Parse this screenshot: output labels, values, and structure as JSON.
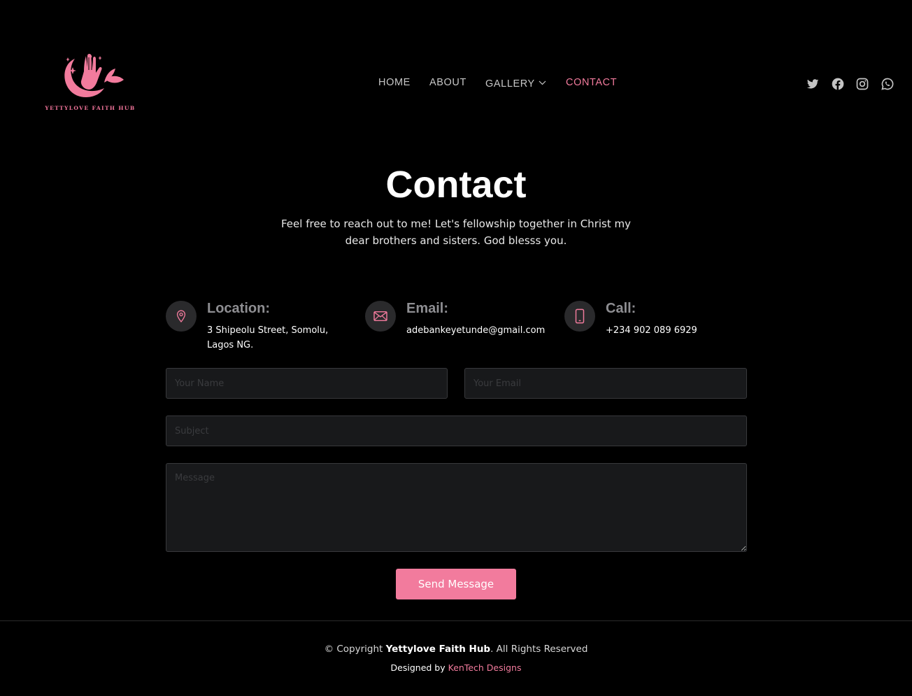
{
  "brand": {
    "logo_text": "YETTYLOVE FAITH HUB",
    "accent_color": "#f27b9d"
  },
  "nav": {
    "items": [
      {
        "label": "HOME"
      },
      {
        "label": "ABOUT"
      },
      {
        "label": "GALLERY"
      },
      {
        "label": "CONTACT",
        "active": true
      }
    ]
  },
  "social": {
    "icons": [
      "twitter-icon",
      "facebook-icon",
      "instagram-icon",
      "whatsapp-icon"
    ]
  },
  "hero": {
    "title": "Contact",
    "intro": "Feel free to reach out to me! Let's fellowship together in Christ my dear brothers and sisters. God blesss you."
  },
  "info": [
    {
      "heading": "Location:",
      "text": "3 Shipeolu Street, Somolu, Lagos NG.",
      "icon": "map-pin-icon"
    },
    {
      "heading": "Email:",
      "text": "adebankeyetunde@gmail.com",
      "icon": "envelope-icon"
    },
    {
      "heading": "Call:",
      "text": "+234 902 089 6929",
      "icon": "phone-icon"
    }
  ],
  "form": {
    "name_placeholder": "Your Name",
    "email_placeholder": "Your Email",
    "subject_placeholder": "Subject",
    "message_placeholder": "Message",
    "submit_label": "Send Message"
  },
  "footer": {
    "copyright_prefix": "© Copyright",
    "brand_name": "Yettylove Faith Hub",
    "copyright_suffix": ". All Rights Reserved",
    "designed_prefix": "Designed by",
    "designer_name": "KenTech Designs"
  }
}
